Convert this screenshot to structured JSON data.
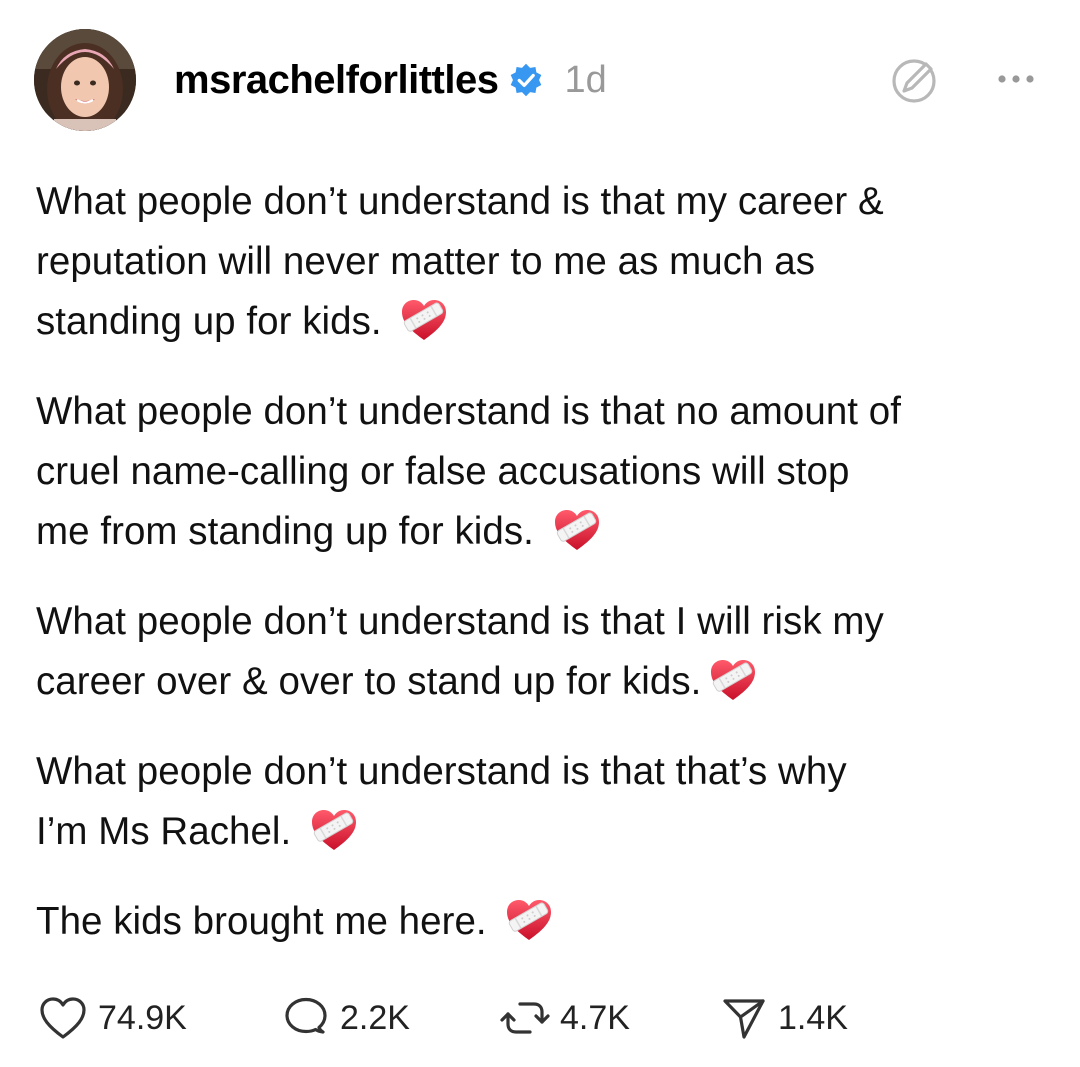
{
  "post": {
    "author": {
      "username": "msrachelforlittles",
      "verified": true,
      "avatar_icon": "profile-photo",
      "time_ago": "1d"
    },
    "header_icons": [
      "edit-circle-icon",
      "more-dots-icon"
    ],
    "paragraphs": [
      {
        "lines": [
          "What people don’t understand is that my career &",
          "reputation will never matter to me as much as",
          "standing up for kids."
        ],
        "emoji": "mending-heart"
      },
      {
        "lines": [
          "What people don’t understand is that no amount of",
          "cruel name-calling or false accusations will stop",
          "me from standing up for kids."
        ],
        "emoji": "mending-heart"
      },
      {
        "lines": [
          "What people don’t understand is that I will risk my",
          "career over & over to stand up for kids."
        ],
        "emoji": "mending-heart"
      },
      {
        "lines": [
          "What people don’t understand is that that’s why",
          "I’m Ms Rachel."
        ],
        "emoji": "mending-heart"
      },
      {
        "lines": [
          "The kids brought me here."
        ],
        "emoji": "mending-heart"
      }
    ],
    "actions": {
      "likes": "74.9K",
      "comments": "2.2K",
      "reposts": "4.7K",
      "shares": "1.4K"
    }
  },
  "colors": {
    "verified_badge": "#3897f0",
    "secondary_text": "#999999",
    "heart_red": "#e8243c"
  }
}
